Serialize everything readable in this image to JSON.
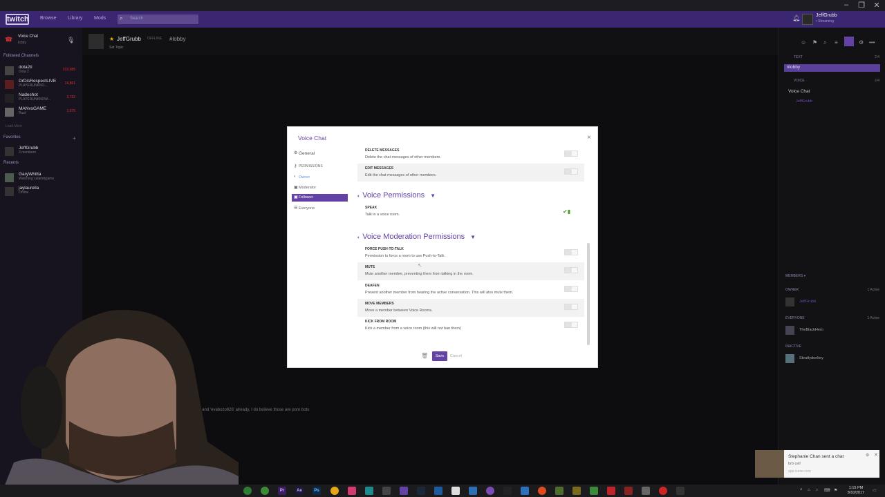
{
  "window": {
    "min": "–",
    "max": "❐",
    "close": "✕"
  },
  "topnav": {
    "logo": "twitch",
    "links": [
      "Browse",
      "Library",
      "Mods"
    ],
    "search_placeholder": "Search",
    "user_name": "JeffGrubb",
    "user_status": "• Streaming"
  },
  "leftbar": {
    "voice_title": "Voice Chat",
    "voice_sub": "lobby",
    "followed_header": "Followed Channels",
    "followed": [
      {
        "name": "dota2ti",
        "sub": "Dota 2",
        "count": "222,085"
      },
      {
        "name": "DrDisRespectLIVE",
        "sub": "PLAYERUNKNO...",
        "count": "24,861"
      },
      {
        "name": "Nadeshot",
        "sub": "PLAYERUNKNOW...",
        "count": "2,732"
      },
      {
        "name": "MANvsGAME",
        "sub": "Rust",
        "count": "1,075"
      }
    ],
    "load_more": "Load More",
    "favorites_header": "Favorites",
    "favorites": [
      {
        "name": "JeffGrubb",
        "sub": "3 members"
      }
    ],
    "recents_header": "Recents",
    "recents": [
      {
        "name": "GaryWhitta",
        "sub": "Watching calamityjame"
      },
      {
        "name": "jaylaurella",
        "sub": "Online"
      }
    ]
  },
  "channel": {
    "name": "JeffGrubb",
    "status": "OFFLINE",
    "room": "#lobby",
    "sub": "Set Topic"
  },
  "chat": {
    "line": "'rstella2532' and 'evabozo626' already, I do believe those are porn bots"
  },
  "rightpanel": {
    "text_header": "TEXT",
    "text_count": "2/4",
    "lobby": "#lobby",
    "voice_header": "VOICE",
    "voice_count": "2/4",
    "voice_room": "Voice Chat",
    "voice_member": "JeffGrubb",
    "members_header": "MEMBERS ▾",
    "owner_header": "OWNER",
    "owner_count": "1 Active",
    "owner_name": "JeffGrubb",
    "everyone_header": "EVERYONE",
    "everyone_count": "1 Active",
    "everyone_name": "TheBlackHero",
    "inactive_header": "INACTIVE",
    "inactive_name": "Skrattydonkey"
  },
  "modal": {
    "title": "Voice Chat",
    "close": "×",
    "nav": {
      "general": "General",
      "permissions": "PERMISSIONS",
      "owner": "Owner",
      "moderator": "Moderator",
      "follower": "Follower",
      "everyone": "Everyone"
    },
    "perms_top": [
      {
        "title": "DELETE MESSAGES",
        "desc": "Delete the chat messages of other members."
      },
      {
        "title": "EDIT MESSAGES",
        "desc": "Edit the chat messages of other members."
      }
    ],
    "voice_section": "Voice Permissions",
    "speak": {
      "title": "SPEAK",
      "desc": "Talk in a voice room."
    },
    "mod_section": "Voice Moderation Permissions",
    "perms_mod": [
      {
        "title": "FORCE PUSH-TO-TALK",
        "desc": "Permission to force a room to use Push-to-Talk."
      },
      {
        "title": "MUTE",
        "desc": "Mute another member, preventing them from talking in the room."
      },
      {
        "title": "DEAFEN",
        "desc": "Prevent another member from hearing the active conversation. This will also mute them."
      },
      {
        "title": "MOVE MEMBERS",
        "desc": "Move a member between Voice Rooms."
      },
      {
        "title": "KICK FROM ROOM",
        "desc": "Kick a member from a voice room (this will not ban them)"
      }
    ],
    "save": "Save",
    "cancel": "Cancel"
  },
  "toast": {
    "title": "Stephanie Chan sent a chat",
    "message": "brb cell",
    "app": "app.curse.com"
  },
  "taskbar": {
    "time": "1:15 PM",
    "date": "8/10/2017"
  }
}
